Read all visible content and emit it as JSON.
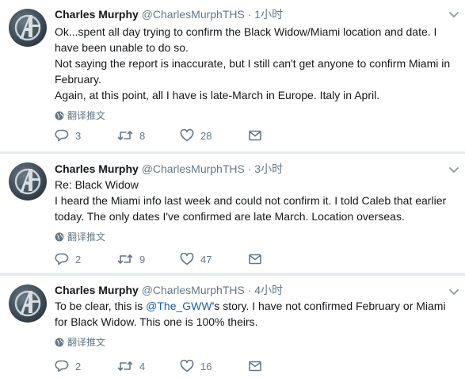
{
  "tweets": [
    {
      "name": "Charles Murphy",
      "handle": "@CharlesMurphTHS",
      "dot": "·",
      "time": "1小时",
      "lines": [
        "Ok...spent all day trying to confirm the Black Widow/Miami location and date. I have been unable to do so.",
        "Not saying the report is inaccurate, but I still can't get anyone to confirm Miami in February.",
        "Again, at this point, all I have is late-March in Europe. Italy in April."
      ],
      "translate": "翻译推文",
      "replies": "3",
      "retweets": "8",
      "likes": "28"
    },
    {
      "name": "Charles Murphy",
      "handle": "@CharlesMurphTHS",
      "dot": "·",
      "time": "3小时",
      "lines": [
        "Re: Black Widow",
        "I heard the Miami info last week and could not confirm it. I told Caleb that earlier today. The only dates I've confirmed are late March. Location overseas."
      ],
      "translate": "翻译推文",
      "replies": "2",
      "retweets": "9",
      "likes": "47"
    },
    {
      "name": "Charles Murphy",
      "handle": "@CharlesMurphTHS",
      "dot": "·",
      "time": "4小时",
      "text_before": "To be clear, this is ",
      "mention": "@The_GWW",
      "text_after": "'s story. I have not confirmed February or Miami for Black Widow. This one is 100% theirs.",
      "translate": "翻译推文",
      "replies": "2",
      "retweets": "4",
      "likes": "16"
    }
  ],
  "icons": {
    "reply": "reply-icon",
    "retweet": "retweet-icon",
    "like": "heart-icon",
    "dm": "envelope-icon",
    "globe": "globe-icon",
    "caret": "chevron-down-icon"
  },
  "colors": {
    "text": "#14171a",
    "secondary": "#657786",
    "mention": "#1b5fa8",
    "divider": "#e6ecf0"
  }
}
